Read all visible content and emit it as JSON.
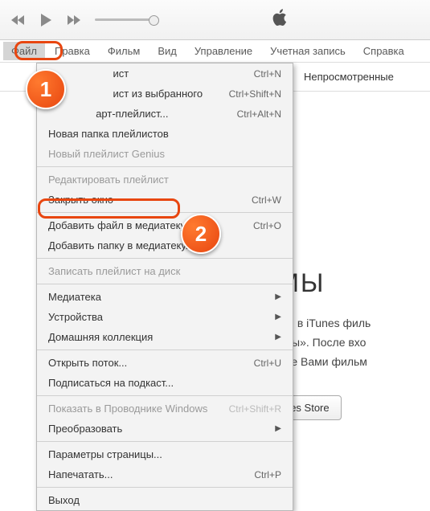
{
  "toolbar": {
    "apple_icon": "apple"
  },
  "menubar": {
    "items": [
      "Файл",
      "Правка",
      "Фильм",
      "Вид",
      "Управление",
      "Учетная запись",
      "Справка"
    ],
    "active_index": 0
  },
  "tabs": {
    "unwatched": "Непросмотренные"
  },
  "content": {
    "heading_fragment": "ЛЬМЫ",
    "line1": "мые Вами в iTunes филь",
    "line2": "и «Фильмы». После вхо",
    "line3": "купленные Вами фильм",
    "store_button": "и в iTunes Store"
  },
  "dropdown": {
    "items": [
      {
        "label": "Новый плейлист",
        "shortcut": "Ctrl+N",
        "visible_label_fragment": "ист"
      },
      {
        "label": "Новый плейлист из выбранного",
        "shortcut": "Ctrl+Shift+N",
        "visible_label_fragment": "ист из выбранного"
      },
      {
        "label": "Новый смарт-плейлист...",
        "shortcut": "Ctrl+Alt+N",
        "visible_label_fragment": "арт-плейлист..."
      },
      {
        "label": "Новая папка плейлистов"
      },
      {
        "label": "Новый плейлист Genius",
        "disabled": true
      },
      {
        "sep": true
      },
      {
        "label": "Редактировать плейлист",
        "disabled": true
      },
      {
        "label": "Закрыть окно",
        "shortcut": "Ctrl+W"
      },
      {
        "sep": true
      },
      {
        "label": "Добавить файл в медиатеку...",
        "shortcut": "Ctrl+O",
        "highlighted": true
      },
      {
        "label": "Добавить папку в медиатеку..."
      },
      {
        "sep": true
      },
      {
        "label": "Записать плейлист на диск",
        "disabled": true
      },
      {
        "sep": true
      },
      {
        "label": "Медиатека",
        "submenu": true
      },
      {
        "label": "Устройства",
        "submenu": true
      },
      {
        "label": "Домашняя коллекция",
        "submenu": true
      },
      {
        "sep": true
      },
      {
        "label": "Открыть поток...",
        "shortcut": "Ctrl+U"
      },
      {
        "label": "Подписаться на подкаст..."
      },
      {
        "sep": true
      },
      {
        "label": "Показать в Проводнике Windows",
        "shortcut": "Ctrl+Shift+R",
        "disabled": true
      },
      {
        "label": "Преобразовать",
        "submenu": true
      },
      {
        "sep": true
      },
      {
        "label": "Параметры страницы..."
      },
      {
        "label": "Напечатать...",
        "shortcut": "Ctrl+P"
      },
      {
        "sep": true
      },
      {
        "label": "Выход"
      }
    ]
  },
  "annotations": {
    "badge1": "1",
    "badge2": "2"
  }
}
